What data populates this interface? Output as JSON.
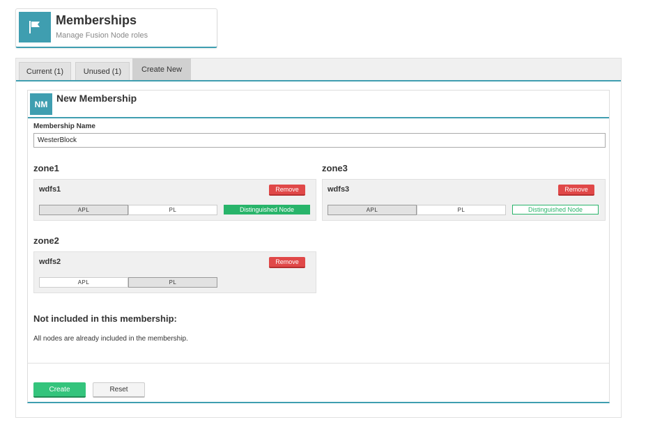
{
  "header": {
    "title": "Memberships",
    "subtitle": "Manage Fusion Node roles",
    "icon": "flag-icon",
    "accent_color": "#3f9eb0"
  },
  "tabs": [
    {
      "label": "Current (1)",
      "active": false
    },
    {
      "label": "Unused (1)",
      "active": false
    },
    {
      "label": "Create New",
      "active": true
    }
  ],
  "membership": {
    "badge": "NM",
    "title": "New Membership",
    "name_label": "Membership Name",
    "name_value": "WesterBlock"
  },
  "zones": {
    "zone1": {
      "title": "zone1",
      "node": "wdfs1",
      "remove_label": "Remove",
      "roles": [
        {
          "label": "APL",
          "selected": true
        },
        {
          "label": "PL",
          "selected": false
        }
      ],
      "distinguished_label": "Distinguished Node",
      "distinguished": true
    },
    "zone3": {
      "title": "zone3",
      "node": "wdfs3",
      "remove_label": "Remove",
      "roles": [
        {
          "label": "APL",
          "selected": true
        },
        {
          "label": "PL",
          "selected": false
        }
      ],
      "distinguished_label": "Distinguished Node",
      "distinguished": false
    },
    "zone2": {
      "title": "zone2",
      "node": "wdfs2",
      "remove_label": "Remove",
      "roles": [
        {
          "label": "APL",
          "selected": false
        },
        {
          "label": "PL",
          "selected": true
        }
      ]
    }
  },
  "not_included": {
    "title": "Not included in this membership:",
    "text": "All nodes are already included in the membership."
  },
  "actions": {
    "create_label": "Create",
    "reset_label": "Reset"
  },
  "colors": {
    "remove": "#e04848",
    "distinguished": "#28b46a",
    "create": "#34c47c"
  }
}
